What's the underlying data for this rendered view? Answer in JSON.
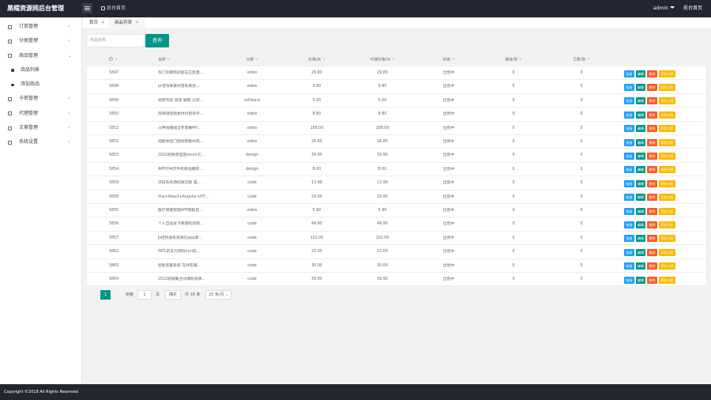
{
  "header": {
    "title": "黑帽资源网后台管理",
    "home_label": "后台首页",
    "user": "admin",
    "front_label": "前台首页"
  },
  "sidebar": {
    "items": [
      {
        "label": "订单管理",
        "icon": "order-icon",
        "expanded": false
      },
      {
        "label": "分类管理",
        "icon": "category-icon",
        "expanded": false
      },
      {
        "label": "商品管理",
        "icon": "goods-icon",
        "expanded": true,
        "children": [
          {
            "label": "商品列表"
          },
          {
            "label": "添加商品"
          }
        ]
      },
      {
        "label": "卡密管理",
        "icon": "card-icon",
        "expanded": false
      },
      {
        "label": "代理管理",
        "icon": "agent-icon",
        "expanded": false
      },
      {
        "label": "文章管理",
        "icon": "article-icon",
        "expanded": false
      },
      {
        "label": "系统设置",
        "icon": "settings-icon",
        "expanded": false
      }
    ]
  },
  "tabs": [
    {
      "label": "首页",
      "close": "✕",
      "active": false
    },
    {
      "label": "商品列表",
      "close": "✕",
      "active": true
    }
  ],
  "search": {
    "placeholder": "商品名称",
    "button": "查询"
  },
  "table": {
    "headers": {
      "id": "ID",
      "name": "名称",
      "category": "分类",
      "price": "价格/元",
      "agent_price": "代理价格/元",
      "status": "状态",
      "stock": "库存/张",
      "sold": "已售/张"
    },
    "actions": {
      "link": "链接",
      "edit": "编辑",
      "delete": "删除",
      "add_card": "添加卡密"
    },
    "rows": [
      {
        "id": "5847",
        "name": "热门风暴购买励志正能量...",
        "category": "video",
        "price": "29.80",
        "agent_price": "29.80",
        "status": "出售中",
        "stock": "0",
        "sold": "0"
      },
      {
        "id": "5848",
        "name": "pr音效库素材音效库剪...",
        "category": "video",
        "price": "9.80",
        "agent_price": "9.80",
        "status": "出售中",
        "stock": "0",
        "sold": "0"
      },
      {
        "id": "5849",
        "name": "视频无损 高速 解限 分割...",
        "category": "software",
        "price": "5.00",
        "agent_price": "5.00",
        "status": "出售中",
        "stock": "0",
        "sold": "0"
      },
      {
        "id": "5850",
        "name": "简单短视频素材抖音快手...",
        "category": "video",
        "price": "8.80",
        "agent_price": "8.80",
        "status": "出售中",
        "stock": "0",
        "sold": "0"
      },
      {
        "id": "5852",
        "name": "火神咕噜唱全罗鼎舞MV...",
        "category": "video",
        "price": "188.00",
        "agent_price": "188.00",
        "status": "出售中",
        "stock": "0",
        "sold": "0"
      },
      {
        "id": "5851",
        "name": "短剧体验门短视频素材快...",
        "category": "video",
        "price": "26.80",
        "agent_price": "26.80",
        "status": "出售中",
        "stock": "0",
        "sold": "0"
      },
      {
        "id": "5853",
        "name": "2022新款原型图axure元...",
        "category": "design",
        "price": "39.90",
        "agent_price": "39.90",
        "status": "出售中",
        "stock": "0",
        "sold": "0"
      },
      {
        "id": "5854",
        "name": "APP引导页手机移动端软...",
        "category": "design",
        "price": "8.00",
        "agent_price": "8.00",
        "status": "出售中",
        "stock": "0",
        "sold": "0"
      },
      {
        "id": "5859",
        "name": "讯码系统源码旗云版 速...",
        "category": "code",
        "price": "13.99",
        "agent_price": "13.99",
        "status": "出售中",
        "stock": "0",
        "sold": "0"
      },
      {
        "id": "5858",
        "name": "Vue+React+Angular+HT...",
        "category": "code",
        "price": "29.90",
        "agent_price": "29.90",
        "status": "出售中",
        "stock": "0",
        "sold": "0"
      },
      {
        "id": "5855",
        "name": "医疗保健管理APP模板前...",
        "category": "video",
        "price": "5.90",
        "agent_price": "5.90",
        "status": "出售中",
        "stock": "0",
        "sold": "0"
      },
      {
        "id": "5856",
        "name": "个人自动发卡网源码测源...",
        "category": "code",
        "price": "49.90",
        "agent_price": "49.90",
        "status": "出售中",
        "stock": "0",
        "sold": "0"
      },
      {
        "id": "5857",
        "name": "Js招时通系统微信app源...",
        "category": "code",
        "price": "102.00",
        "agent_price": "102.00",
        "status": "出售中",
        "stock": "0",
        "sold": "0"
      },
      {
        "id": "5862",
        "name": "INTL的支付源码iryn码...",
        "category": "code",
        "price": "23.00",
        "agent_price": "23.00",
        "status": "出售中",
        "stock": "0",
        "sold": "0"
      },
      {
        "id": "5863",
        "name": "智能客服系统 在线客服...",
        "category": "code",
        "price": "30.00",
        "agent_price": "30.00",
        "status": "出售中",
        "stock": "0",
        "sold": "0"
      },
      {
        "id": "5864",
        "name": "2022新版聚合双端影视源...",
        "category": "code",
        "price": "39.90",
        "agent_price": "39.90",
        "status": "出售中",
        "stock": "0",
        "sold": "0"
      }
    ]
  },
  "pagination": {
    "prev": "‹",
    "current_page": "1",
    "next": "›",
    "goto_label": "到第",
    "goto_value": "1",
    "page_unit": "页",
    "confirm": "确定",
    "total": "共 16 条",
    "page_size": "20 条/页 ⌄"
  },
  "footer": {
    "copyright": "Copyright ©2018 All Rights Reserved"
  },
  "colors": {
    "header_bg": "#23262e",
    "primary": "#009688",
    "link": "#1e9fff",
    "danger": "#ff5722",
    "warn": "#ffb800"
  }
}
